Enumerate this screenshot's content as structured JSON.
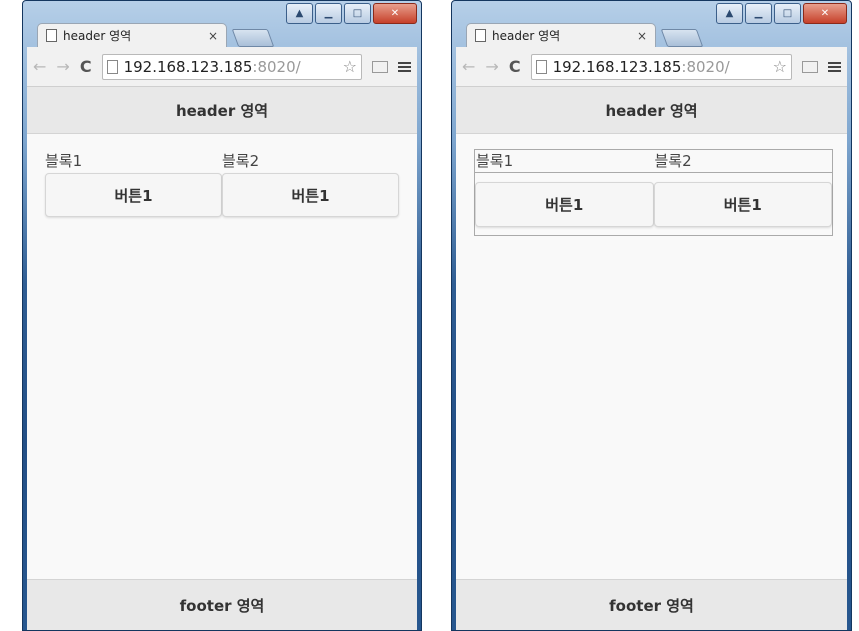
{
  "left_window": {
    "tab_title": "header 영역",
    "tab_close": "×",
    "url_host": "192.168.123.185",
    "url_rest": ":8020/",
    "page_header": "header 영역",
    "page_footer": "footer 영역",
    "blocks": [
      {
        "label": "블록1",
        "button": "버튼1"
      },
      {
        "label": "블록2",
        "button": "버튼1"
      }
    ]
  },
  "right_window": {
    "tab_title": "header 영역",
    "tab_close": "×",
    "url_host": "192.168.123.185",
    "url_rest": ":8020/",
    "page_header": "header 영역",
    "page_footer": "footer 영역",
    "blocks": [
      {
        "label": "블록1",
        "button": "버튼1"
      },
      {
        "label": "블록2",
        "button": "버튼1"
      }
    ]
  },
  "icons": {
    "back": "←",
    "forward": "→",
    "reload": "C",
    "star": "☆"
  }
}
